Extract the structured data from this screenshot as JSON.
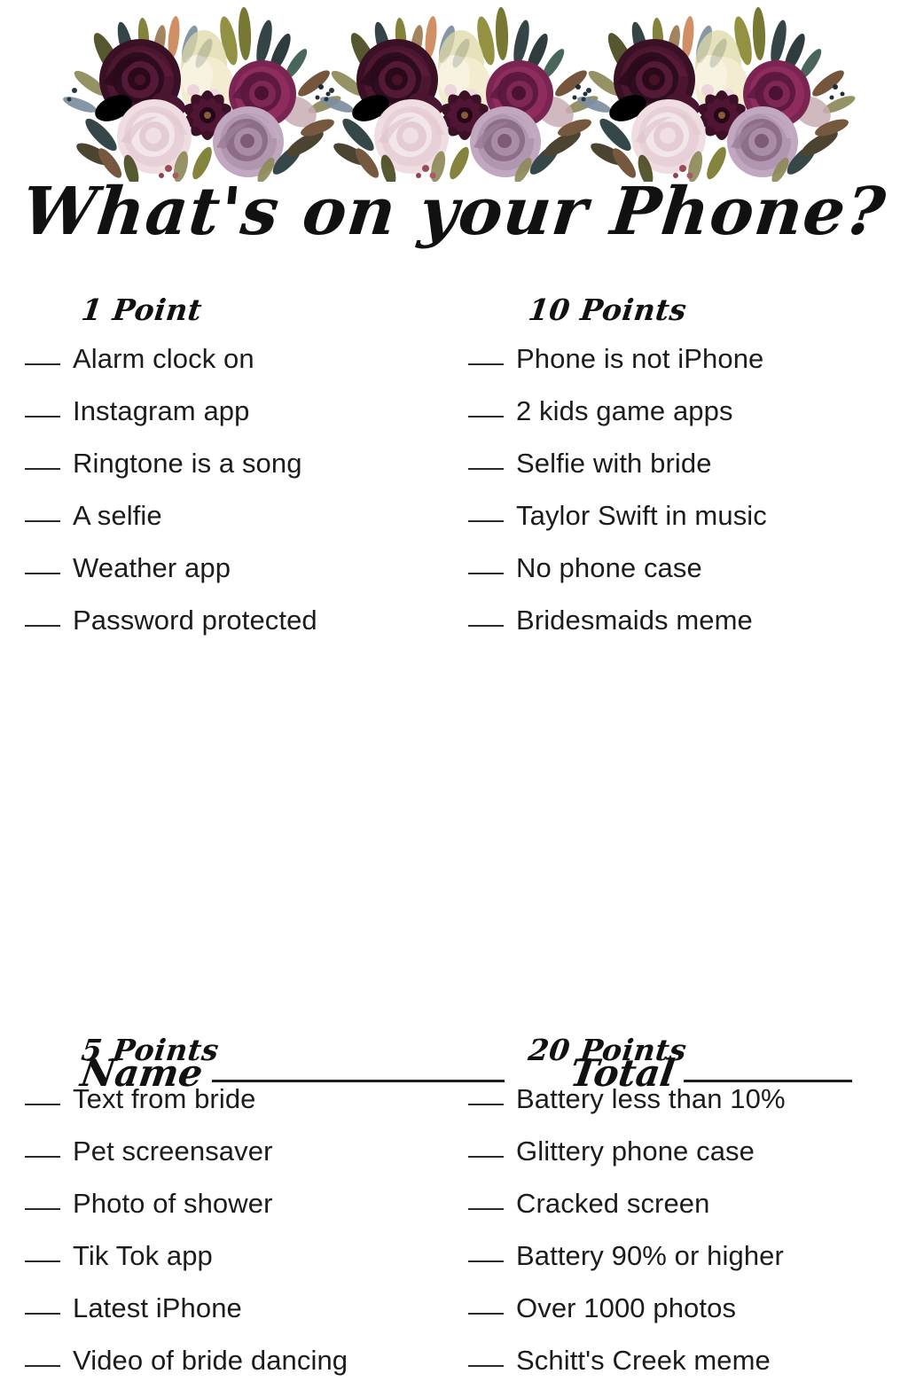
{
  "page": {
    "title": "What's on your Phone?",
    "background_color": "#ffffff",
    "text_color": "#1c1c1c"
  },
  "decor": {
    "floral_band_name": "watercolor-floral-border",
    "palette": {
      "deep_burgundy": "#45132c",
      "dark_plum": "#2d0c1d",
      "magenta_plum": "#8e2c5e",
      "mauve_rose": "#b99bb5",
      "dusty_pink": "#e3cad6",
      "blush_cream": "#f2e2dd",
      "olive_green": "#7a7a2e",
      "dark_teal": "#26383a",
      "tan_leaf": "#9b7b52",
      "brown_leaf": "#6b4a2e",
      "slate_blue": "#7d8fa0",
      "pale_yellow": "#ded9a6"
    },
    "repeat_count": 3
  },
  "columns": [
    {
      "side": "left",
      "sections": [
        {
          "heading": "1 Point",
          "points": 1,
          "items": [
            "Alarm clock on",
            "Instagram app",
            "Ringtone is a song",
            "A selfie",
            "Weather app",
            "Password protected"
          ]
        },
        {
          "heading": "5 Points",
          "points": 5,
          "items": [
            "Text from bride",
            "Pet screensaver",
            "Photo of shower",
            "Tik Tok app",
            "Latest iPhone",
            "Video of bride dancing"
          ]
        }
      ]
    },
    {
      "side": "right",
      "sections": [
        {
          "heading": "10 Points",
          "points": 10,
          "items": [
            "Phone is not iPhone",
            "2 kids game apps",
            "Selfie with bride",
            "Taylor Swift in music",
            "No phone case",
            "Bridesmaids meme"
          ]
        },
        {
          "heading": "20 Points",
          "points": 20,
          "items": [
            "Battery less than 10%",
            "Glittery phone case",
            "Cracked screen",
            "Battery 90% or higher",
            "Over 1000 photos",
            "Schitt's Creek meme"
          ]
        }
      ]
    }
  ],
  "footer": {
    "name_label": "Name",
    "total_label": "Total"
  }
}
